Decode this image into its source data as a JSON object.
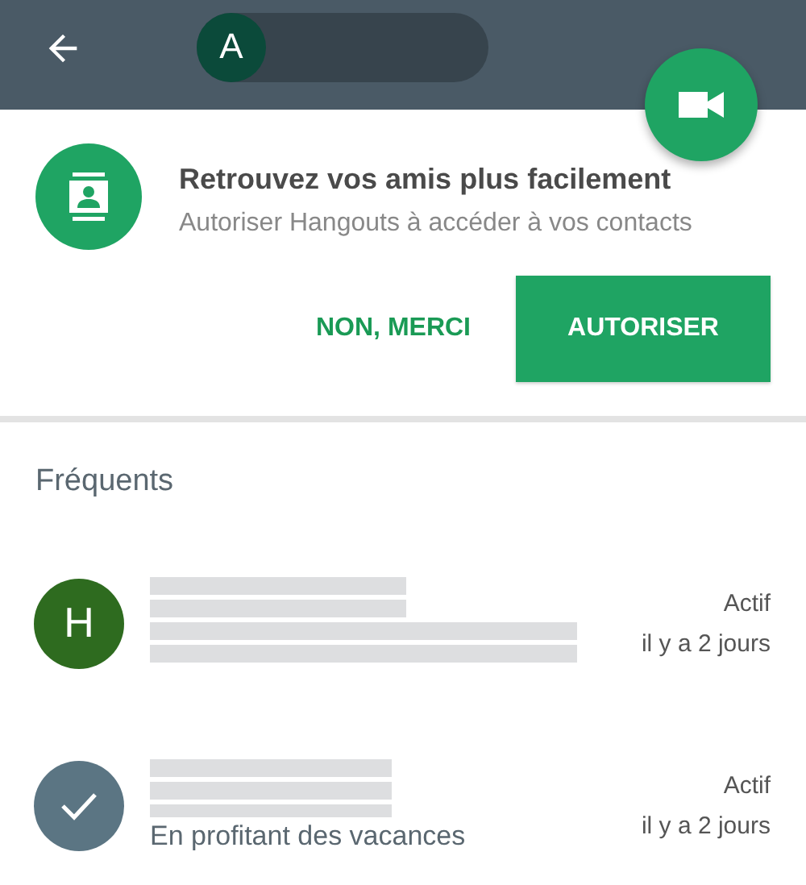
{
  "toolbar": {
    "avatar_initial": "A"
  },
  "banner": {
    "title": "Retrouvez vos amis plus facilement",
    "subtitle": "Autoriser Hangouts à accéder à vos contacts",
    "buttons": [
      {
        "label": "NON, MERCI",
        "kind": "text"
      },
      {
        "label": "AUTORISER",
        "kind": "filled"
      }
    ]
  },
  "section_title": "Fréquents",
  "contacts": [
    {
      "initial": "H",
      "color": "#2e6b1f",
      "selected": false,
      "status": "Actif",
      "time": "il y a 2 jours"
    },
    {
      "color": "#5b7583",
      "selected": true,
      "message": "En profitant des vacances",
      "status": "Actif",
      "time": "il y a 2 jours"
    }
  ]
}
